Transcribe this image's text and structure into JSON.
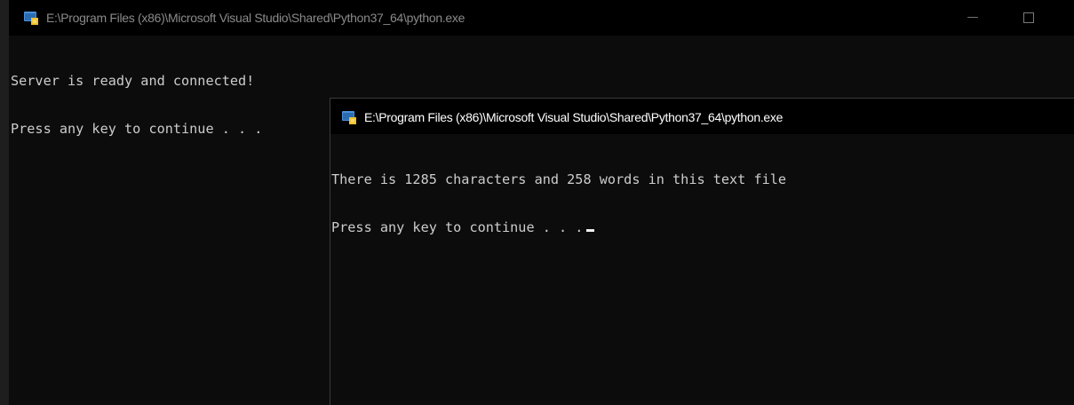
{
  "windows": [
    {
      "title": "E:\\Program Files (x86)\\Microsoft Visual Studio\\Shared\\Python37_64\\python.exe",
      "icon": "python-app-icon",
      "controls": {
        "minimize": "—"
      },
      "console_lines": [
        "Server is ready and connected!",
        "Press any key to continue . . ."
      ]
    },
    {
      "title": "E:\\Program Files (x86)\\Microsoft Visual Studio\\Shared\\Python37_64\\python.exe",
      "icon": "python-app-icon",
      "console_lines": [
        "There is 1285 characters and 258 words in this text file",
        "Press any key to continue . . ."
      ]
    }
  ],
  "colors": {
    "console_bg": "#0c0c0c",
    "console_text": "#cccccc",
    "titlebar_bg": "#000000",
    "inactive_title": "#8a8a8a",
    "active_title": "#ffffff"
  }
}
